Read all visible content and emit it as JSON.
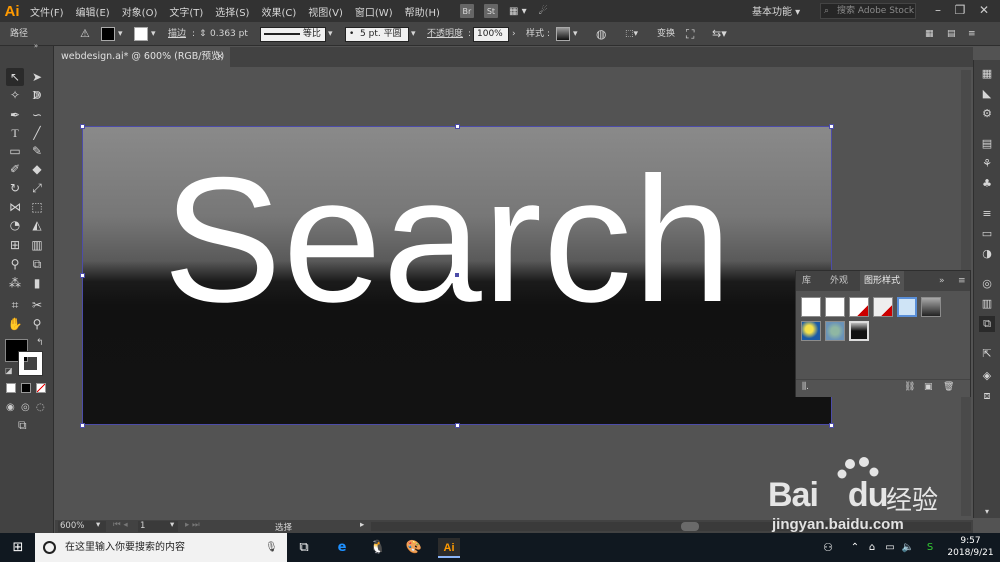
{
  "app": {
    "logo": "Ai",
    "accent": "#ff9a00"
  },
  "menu": [
    "文件(F)",
    "编辑(E)",
    "对象(O)",
    "文字(T)",
    "选择(S)",
    "效果(C)",
    "视图(V)",
    "窗口(W)",
    "帮助(H)"
  ],
  "menubar": {
    "br": "Br",
    "st": "St",
    "workspace": "基本功能",
    "stock_search_placeholder": "搜索 Adobe Stock"
  },
  "controlbar": {
    "selection_type": "路径",
    "stroke_label": "描边",
    "stroke_value": "0.363 pt",
    "stroke_profile": "等比",
    "brush": "5 pt. 平圆",
    "opacity_label": "不透明度",
    "opacity_value": "100%",
    "style_label": "样式",
    "transform": "变换"
  },
  "document": {
    "tab_title": "webdesign.ai* @ 600% (RGB/预览)",
    "close": "×"
  },
  "artboard": {
    "text": "Search",
    "text_color": "#ffffff",
    "selection_color": "#4c4ca8"
  },
  "graphic_styles_panel": {
    "tabs": [
      "库",
      "外观",
      "图形样式"
    ],
    "active_tab": "图形样式",
    "menu_icon": "≡"
  },
  "status": {
    "zoom": "600%",
    "artboard_num": "1",
    "tool": "选择"
  },
  "taskbar": {
    "search_placeholder": "在这里输入你要搜索的内容",
    "time": "9:57",
    "date": "2018/9/21",
    "ai_label": "Ai"
  },
  "watermark": {
    "brand": "Bai",
    "brand2": "du",
    "cn": "经验",
    "url": "jingyan.baidu.com"
  }
}
